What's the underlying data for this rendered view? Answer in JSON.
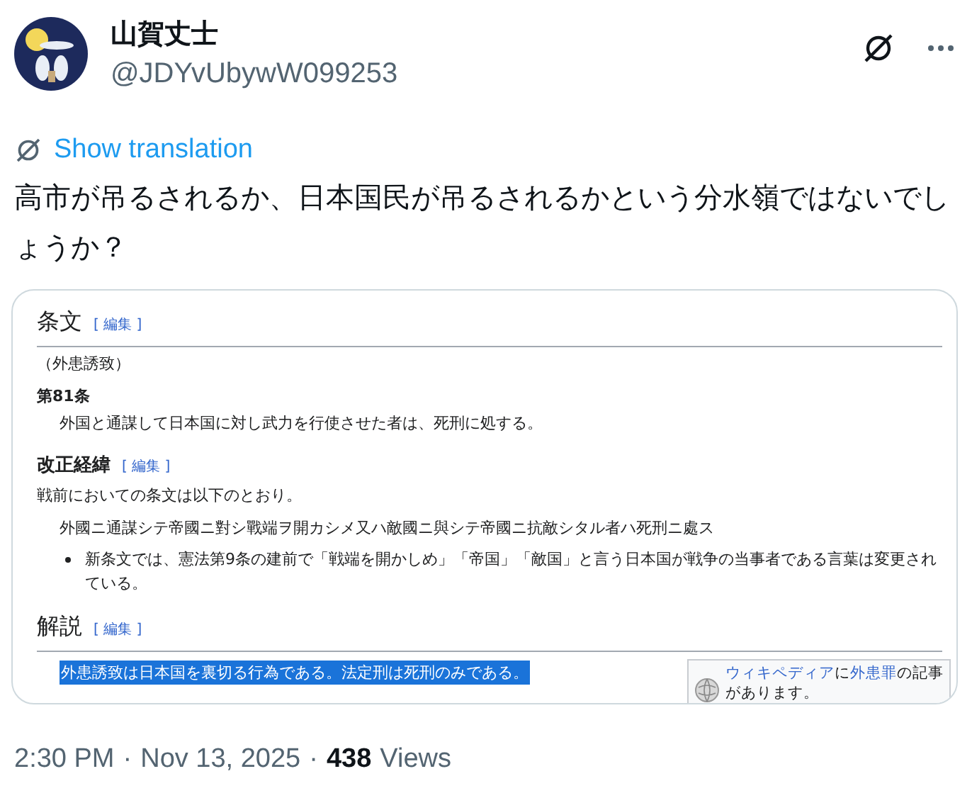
{
  "post": {
    "author": "山賀丈士",
    "handle": "@JDYvUbywW099253",
    "translate_label": "Show translation",
    "text": "高市が吊るされるか、日本国民が吊るされるかという分水嶺ではないでしょうか？"
  },
  "attachment": {
    "blocks": [
      {
        "kind": "heading",
        "text": "条文",
        "edit": "[ 編集 ]"
      },
      {
        "kind": "paragraph",
        "text": "（外患誘致）"
      },
      {
        "kind": "label",
        "text": "第81条"
      },
      {
        "kind": "indented",
        "text": "外国と通謀して日本国に対し武力を行使させた者は、死刑に処する。"
      },
      {
        "kind": "subheading",
        "text": "改正経緯",
        "edit": "[ 編集 ]"
      },
      {
        "kind": "paragraph",
        "text": "戦前においての条文は以下のとおり。"
      },
      {
        "kind": "indented",
        "text": "外國ニ通謀シテ帝國ニ對シ戰端ヲ開カシメ又ハ敵國ニ與シテ帝國ニ抗敵シタル者ハ死刑ニ處ス"
      },
      {
        "kind": "bullet",
        "text": "新条文では、憲法第9条の建前で「戦端を開かしめ」「帝国」「敵国」と言う日本国が戦争の当事者である言葉は変更されている。"
      },
      {
        "kind": "heading",
        "text": "解説",
        "edit": "[ 編集 ]"
      },
      {
        "kind": "highlight_row",
        "text": "外患誘致は日本国を裏切る行為である。法定刑は死刑のみである。",
        "selected": true,
        "sidebox": [
          {
            "kind": "link",
            "text": "ウィキペディア"
          },
          {
            "kind": "plain",
            "text": "に"
          },
          {
            "kind": "link",
            "text": "外患罪"
          },
          {
            "kind": "plain",
            "text": "の記事があります。"
          }
        ]
      }
    ]
  },
  "footer": {
    "time": "2:30 PM",
    "separator_1": "·",
    "date": "Nov 13, 2025",
    "separator_2": "·",
    "views_count": "438",
    "views_label": "Views"
  }
}
